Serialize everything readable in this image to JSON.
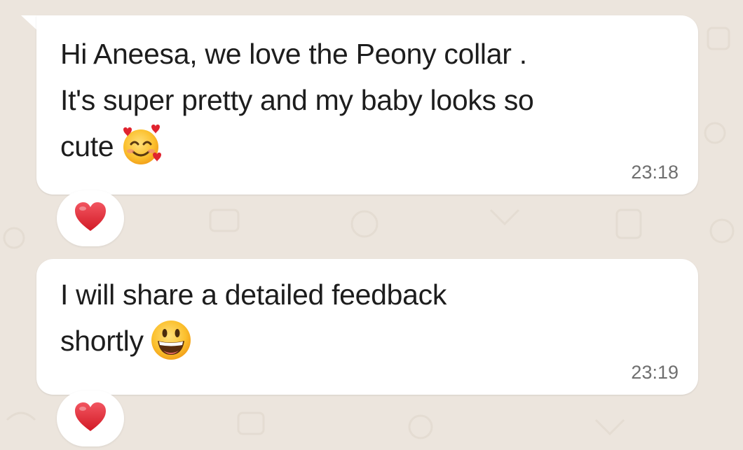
{
  "messages": [
    {
      "lines": [
        "Hi Aneesa, we love the Peony collar .",
        "It's super pretty and my baby looks so",
        "cute"
      ],
      "emoji": "smiling-face-with-hearts",
      "time": "23:18",
      "reaction": "heart"
    },
    {
      "lines": [
        "I will share a detailed feedback",
        "shortly"
      ],
      "emoji": "grinning-face",
      "time": "23:19",
      "reaction": "heart"
    }
  ],
  "colors": {
    "background": "#ece5dd",
    "bubble": "#ffffff",
    "text": "#1d1d1d",
    "timestamp": "#6f6f6f",
    "heart": "#e0232e"
  }
}
